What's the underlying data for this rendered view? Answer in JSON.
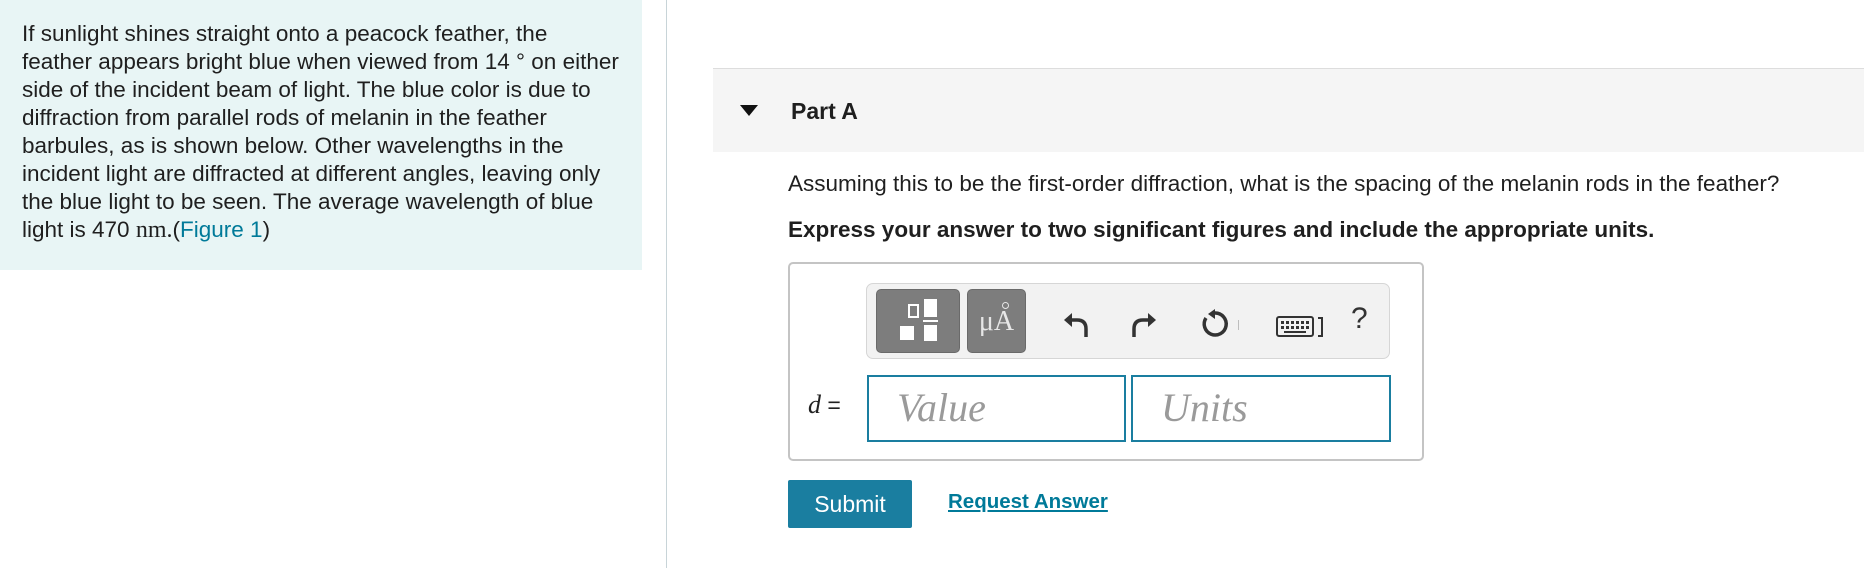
{
  "problem": {
    "text": "If sunlight shines straight onto a peacock feather, the feather appears bright blue when viewed from 14 ° on either side of the incident beam of light. The blue color is due to diffraction from parallel rods of melanin in the feather barbules, as is shown below. Other wavelengths in the incident light are diffracted at different angles, leaving only the blue light to be seen. The average wavelength of blue light is 470",
    "unit": "nm",
    "period": ".",
    "open_paren": "(",
    "figure_link": "Figure 1",
    "close_paren": ")"
  },
  "part": {
    "title": "Part A"
  },
  "question": "Assuming this to be the first-order diffraction, what is the spacing of the melanin rods in the feather?",
  "instruction": "Express your answer to two significant figures and include the appropriate units.",
  "answer": {
    "variable": "d",
    "equals": "=",
    "value_placeholder": "Value",
    "units_placeholder": "Units",
    "units_button_label": "μA",
    "help_label": "?"
  },
  "actions": {
    "submit_label": "Submit",
    "request_label": "Request Answer"
  },
  "colors": {
    "accent": "#1a7ea0",
    "link": "#007a99",
    "problem_bg": "#e8f5f5"
  }
}
